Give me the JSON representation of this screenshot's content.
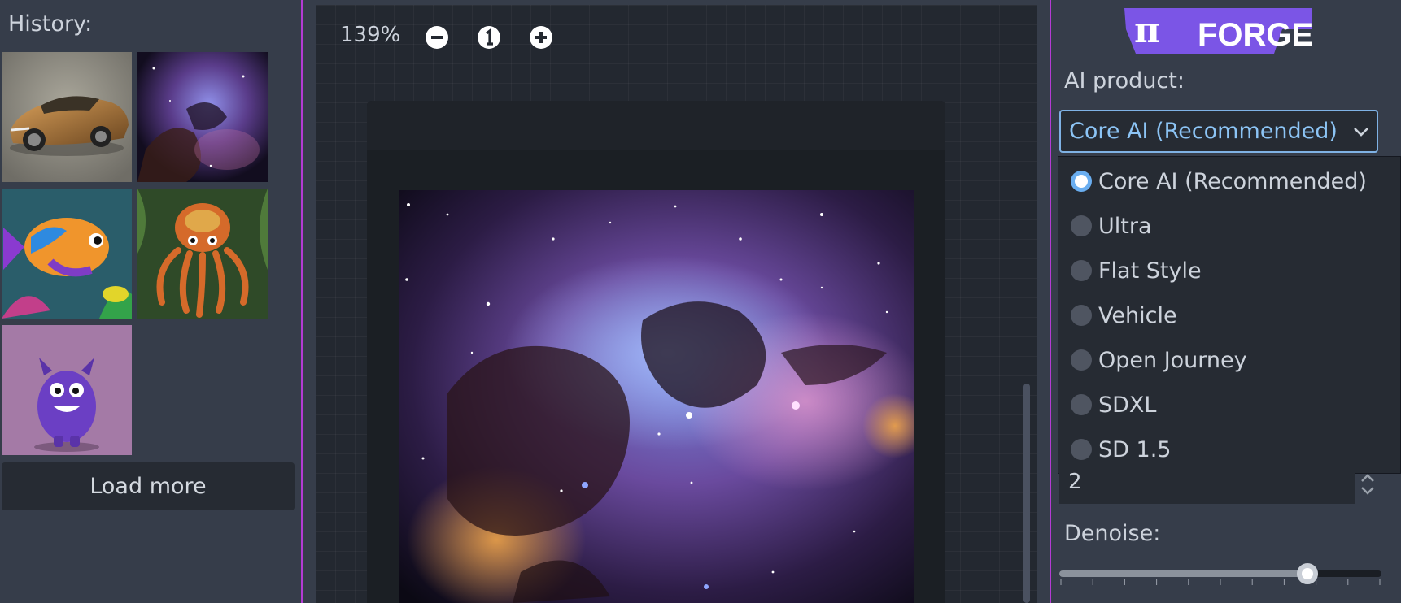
{
  "history": {
    "title": "History:",
    "load_more_label": "Load more",
    "thumbnails": [
      {
        "subject": "car"
      },
      {
        "subject": "nebula"
      },
      {
        "subject": "tropical-fish"
      },
      {
        "subject": "octopus"
      },
      {
        "subject": "purple-monster"
      }
    ]
  },
  "canvas": {
    "zoom_label": "139%",
    "zoom_out_icon": "minus-circle-icon",
    "zoom_reset_icon": "one-circle-icon",
    "zoom_in_icon": "plus-circle-icon",
    "image_subject": "nebula"
  },
  "settings": {
    "logo_text": "FORGE",
    "product_label": "AI product:",
    "selected_product": "Core AI (Recommended)",
    "options": [
      {
        "label": "Core AI (Recommended)",
        "selected": true
      },
      {
        "label": "Ultra",
        "selected": false
      },
      {
        "label": "Flat Style",
        "selected": false
      },
      {
        "label": "Vehicle",
        "selected": false
      },
      {
        "label": "Open Journey",
        "selected": false
      },
      {
        "label": "SDXL",
        "selected": false
      },
      {
        "label": "SD 1.5",
        "selected": false
      }
    ],
    "number_value": "2",
    "denoise_label": "Denoise:",
    "denoise_level": 0.77
  },
  "colors": {
    "accent": "#7fb2e5",
    "divider": "#b43bd4",
    "logo": "#7b55e6"
  }
}
